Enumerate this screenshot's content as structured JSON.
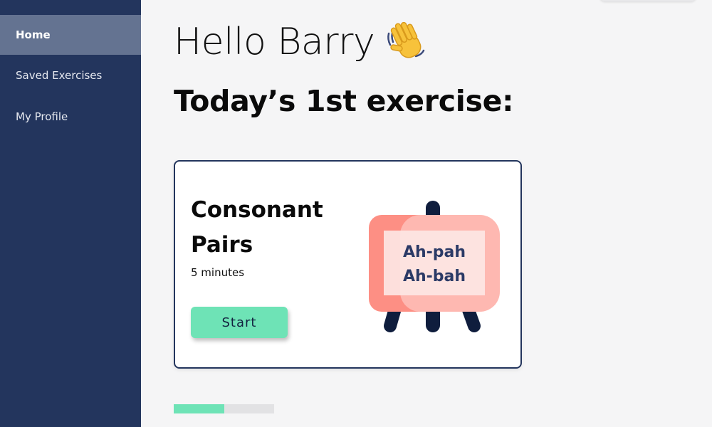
{
  "sidebar": {
    "items": [
      {
        "label": "Home",
        "active": true
      },
      {
        "label": "Saved Exercises",
        "active": false
      },
      {
        "label": "My Profile",
        "active": false
      }
    ]
  },
  "main": {
    "greeting": "Hello Barry",
    "greeting_icon": "waving-hand-icon",
    "heading": "Today’s 1st exercise:",
    "exercise": {
      "title": "Consonant Pairs",
      "duration": "5 minutes",
      "start_label": "Start",
      "board_lines": [
        "Ah-pah",
        "Ah-bah"
      ],
      "illustration_icon": "easel-board-icon"
    },
    "progress": {
      "fraction": 0.5
    }
  },
  "colors": {
    "sidebar_bg": "#23355d",
    "sidebar_active": "#647391",
    "accent_green": "#6ee3b6",
    "board_pink": "#fd8f84",
    "board_light": "#feb8b1",
    "board_text": "#2b3a66"
  }
}
